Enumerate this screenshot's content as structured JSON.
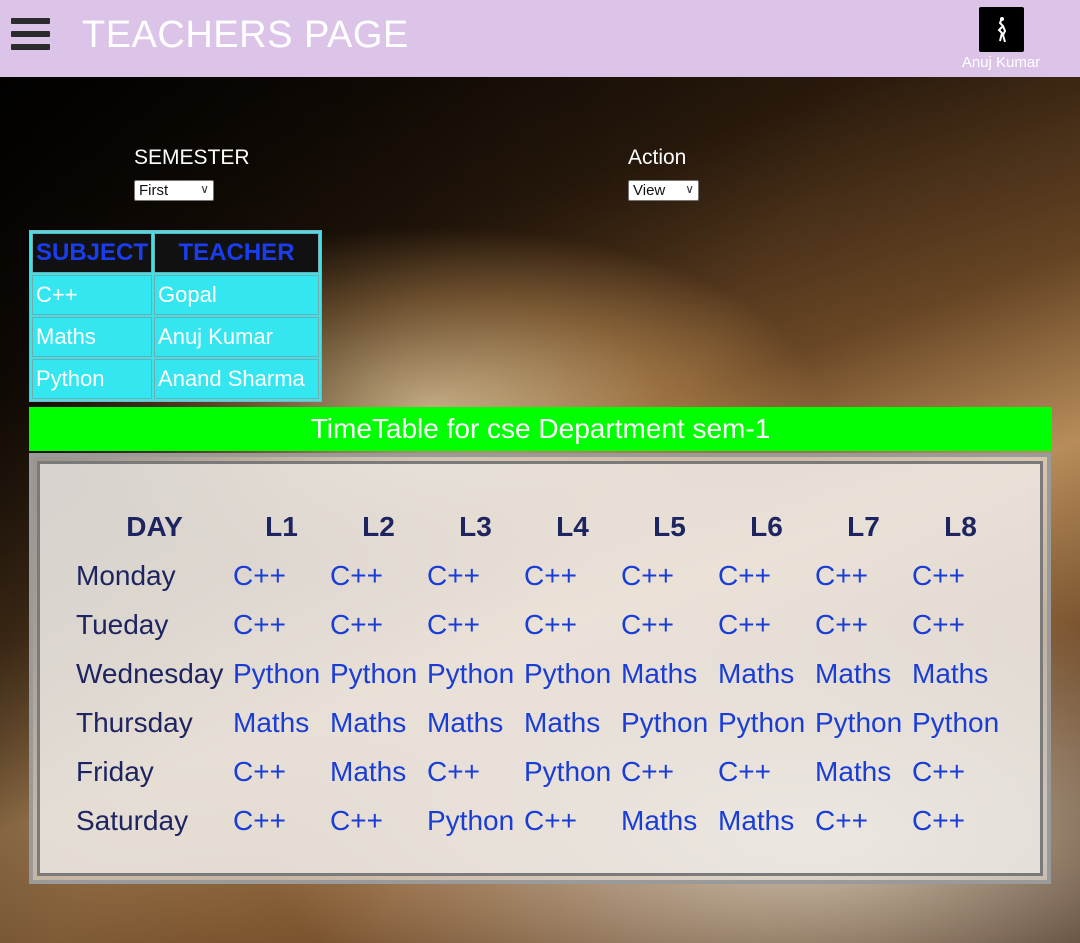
{
  "header": {
    "title": "TEACHERS PAGE",
    "user_name": "Anuj Kumar"
  },
  "form": {
    "semester_label": "SEMESTER",
    "semester_value": "First",
    "action_label": "Action",
    "action_value": "View"
  },
  "subjects": {
    "headers": [
      "SUBJECT",
      "TEACHER"
    ],
    "rows": [
      {
        "subject": "C++",
        "teacher": "Gopal"
      },
      {
        "subject": "Maths",
        "teacher": "Anuj Kumar"
      },
      {
        "subject": "Python",
        "teacher": "Anand Sharma"
      }
    ]
  },
  "timetable": {
    "title": "TimeTable for cse Department sem-1",
    "headers": [
      "DAY",
      "L1",
      "L2",
      "L3",
      "L4",
      "L5",
      "L6",
      "L7",
      "L8"
    ],
    "rows": [
      {
        "day": "Monday",
        "lectures": [
          "C++",
          "C++",
          "C++",
          "C++",
          "C++",
          "C++",
          "C++",
          "C++"
        ]
      },
      {
        "day": "Tueday",
        "lectures": [
          "C++",
          "C++",
          "C++",
          "C++",
          "C++",
          "C++",
          "C++",
          "C++"
        ]
      },
      {
        "day": "Wednesday",
        "lectures": [
          "Python",
          "Python",
          "Python",
          "Python",
          "Maths",
          "Maths",
          "Maths",
          "Maths"
        ]
      },
      {
        "day": "Thursday",
        "lectures": [
          "Maths",
          "Maths",
          "Maths",
          "Maths",
          "Python",
          "Python",
          "Python",
          "Python"
        ]
      },
      {
        "day": "Friday",
        "lectures": [
          "C++",
          "Maths",
          "C++",
          "Python",
          "C++",
          "C++",
          "Maths",
          "C++"
        ]
      },
      {
        "day": "Saturday",
        "lectures": [
          "C++",
          "C++",
          "Python",
          "C++",
          "Maths",
          "Maths",
          "C++",
          "C++"
        ]
      }
    ]
  },
  "colors": {
    "header_bg": "#dcc4e8",
    "banner_bg": "#00ff00",
    "subject_table_bg": "#33e6f0",
    "subject_header_text": "#1a3df0",
    "lecture_text": "#1a3dd6",
    "day_text": "#1d2460"
  },
  "icons": {
    "menu": "hamburger-menu-icon",
    "avatar": "user-avatar"
  }
}
